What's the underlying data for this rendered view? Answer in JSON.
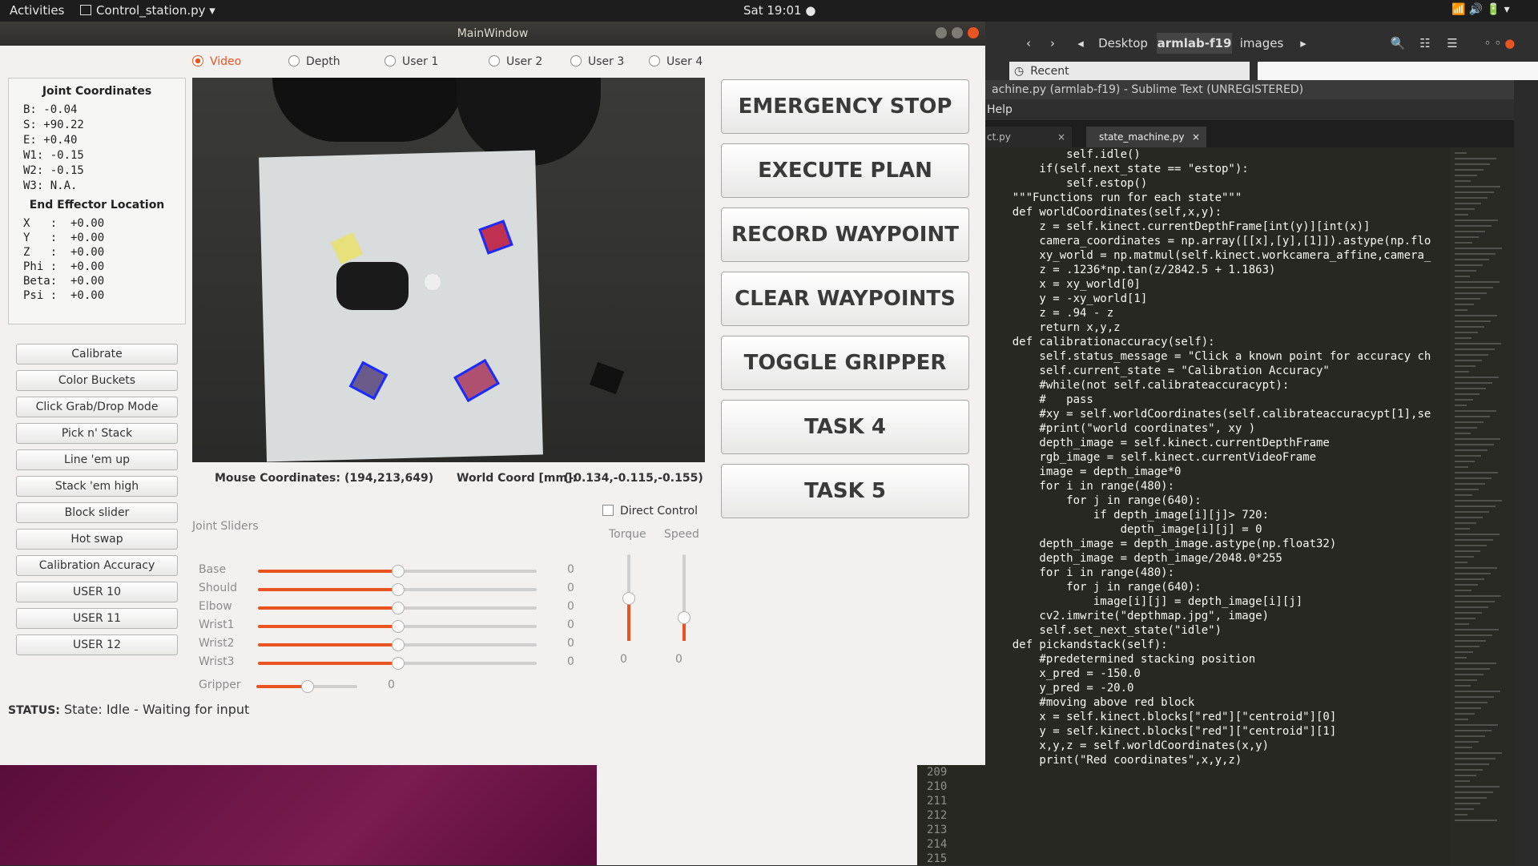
{
  "topbar": {
    "activities": "Activities",
    "app_menu": "Control_station.py ▾",
    "clock": "Sat 19:01 ●"
  },
  "file_manager": {
    "path": [
      "Desktop",
      "armlab-f19",
      "images"
    ],
    "recent": "Recent"
  },
  "sublime": {
    "title": "achine.py (armlab-f19) - Sublime Text (UNREGISTERED)",
    "menu": "Help",
    "tabs": [
      "ct.py",
      "state_machine.py"
    ],
    "code": [
      "            self.idle()",
      "        if(self.next_state == \"estop\"):",
      "            self.estop()",
      "",
      "    \"\"\"Functions run for each state\"\"\"",
      "    def worldCoordinates(self,x,y):",
      "        z = self.kinect.currentDepthFrame[int(y)][int(x)]",
      "        camera_coordinates = np.array([[x],[y],[1]]).astype(np.flo",
      "        xy_world = np.matmul(self.kinect.workcamera_affine,camera_",
      "        z = .1236*np.tan(z/2842.5 + 1.1863)",
      "        x = xy_world[0]",
      "        y = -xy_world[1]",
      "        z = .94 - z",
      "        return x,y,z",
      "",
      "",
      "    def calibrationaccuracy(self):",
      "        self.status_message = \"Click a known point for accuracy ch",
      "        self.current_state = \"Calibration Accuracy\"",
      "        #while(not self.calibrateaccuracypt):",
      "        #   pass",
      "        #xy = self.worldCoordinates(self.calibrateaccuracypt[1],se",
      "        #print(\"world coordinates\", xy )",
      "        depth_image = self.kinect.currentDepthFrame",
      "        rgb_image = self.kinect.currentVideoFrame",
      "        image = depth_image*0",
      "        for i in range(480):",
      "            for j in range(640):",
      "                if depth_image[i][j]> 720:",
      "                    depth_image[i][j] = 0",
      "",
      "        depth_image = depth_image.astype(np.float32)",
      "        depth_image = depth_image/2048.0*255",
      "        for i in range(480):",
      "            for j in range(640):",
      "                image[i][j] = depth_image[i][j]",
      "        cv2.imwrite(\"depthmap.jpg\", image)",
      "        self.set_next_state(\"idle\")",
      "",
      "    def pickandstack(self):",
      "        #predetermined stacking position",
      "        x_pred = -150.0",
      "        y_pred = -20.0",
      "",
      "        #moving above red block",
      "        x = self.kinect.blocks[\"red\"][\"centroid\"][0]",
      "        y = self.kinect.blocks[\"red\"][\"centroid\"][1]",
      "        x,y,z = self.worldCoordinates(x,y)",
      "        print(\"Red coordinates\",x,y,z)"
    ],
    "line_numbers": [
      "209",
      "210",
      "211",
      "212",
      "213",
      "214",
      "215"
    ]
  },
  "main": {
    "title": "MainWindow",
    "radios": [
      {
        "label": "Video",
        "checked": true
      },
      {
        "label": "Depth",
        "checked": false
      },
      {
        "label": "User 1",
        "checked": false
      },
      {
        "label": "User 2",
        "checked": false
      },
      {
        "label": "User 3",
        "checked": false
      },
      {
        "label": "User 4",
        "checked": false
      }
    ],
    "joint": {
      "title": "Joint Coordinates",
      "rows": [
        "B: -0.04",
        "S: +90.22",
        "E: +0.40",
        "W1: -0.15",
        "W2: -0.15",
        "W3: N.A."
      ],
      "ee_title": "End Effector Location",
      "ee_rows": [
        "X   :  +0.00",
        "Y   :  +0.00",
        "Z   :  +0.00",
        "Phi :  +0.00",
        "Beta:  +0.00",
        "Psi :  +0.00"
      ]
    },
    "side_buttons": [
      "Calibrate",
      "Color Buckets",
      "Click Grab/Drop Mode",
      "Pick n' Stack",
      "Line 'em up",
      "Stack 'em high",
      "Block slider",
      "Hot swap",
      "Calibration Accuracy",
      "USER 10",
      "USER 11",
      "USER 12"
    ],
    "big_buttons": [
      "EMERGENCY STOP",
      "EXECUTE PLAN",
      "RECORD WAYPOINT",
      "CLEAR WAYPOINTS",
      "TOGGLE GRIPPER",
      "TASK 4",
      "TASK 5"
    ],
    "mouse_label": "Mouse Coordinates:",
    "mouse_value": "(194,213,649)",
    "world_label": "World Coord [mm]:",
    "world_value": "(-0.134,-0.115,-0.155)",
    "sliders_title": "Joint Sliders",
    "sliders": [
      {
        "label": "Base",
        "value": "0",
        "level": 0.5
      },
      {
        "label": "Should",
        "value": "0",
        "level": 0.5
      },
      {
        "label": "Elbow",
        "value": "0",
        "level": 0.5
      },
      {
        "label": "Wrist1",
        "value": "0",
        "level": 0.5
      },
      {
        "label": "Wrist2",
        "value": "0",
        "level": 0.5
      },
      {
        "label": "Wrist3",
        "value": "0",
        "level": 0.5
      }
    ],
    "gripper": {
      "label": "Gripper",
      "value": "0",
      "level": 0.5
    },
    "direct_control": "Direct Control",
    "torque": {
      "label": "Torque",
      "value": "0",
      "level": 0.5
    },
    "speed": {
      "label": "Speed",
      "value": "0",
      "level": 0.28
    },
    "status_label": "STATUS:",
    "status_text": "State: Idle - Waiting for input"
  },
  "colors": {
    "accent": "#e95420",
    "title_bar": "#3c3b37",
    "desktop": "#7a1c4f"
  }
}
